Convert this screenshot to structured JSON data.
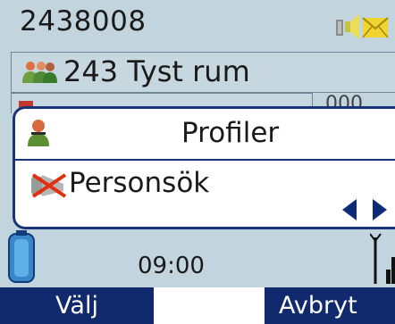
{
  "header": {
    "extension": "2438008",
    "icons": [
      "headset-icon",
      "speaker-icon",
      "envelope-icon"
    ]
  },
  "profile_row": {
    "icon": "group-icon",
    "label": "243 Tyst rum"
  },
  "hidden_row": {
    "time_fragment": "000"
  },
  "popup": {
    "title": "Profiler",
    "title_icon": "person-icon",
    "option_label": "Personsök",
    "option_icon": "muted-pager-icon",
    "nav_icons": [
      "arrow-left-icon",
      "arrow-right-icon"
    ]
  },
  "status": {
    "clock": "09:00",
    "icons": [
      "battery-icon",
      "signal-icon"
    ]
  },
  "softkeys": {
    "left": "Välj",
    "right": "Avbryt"
  },
  "colors": {
    "background": "#c2d4dd",
    "softkey_bar": "#112a6d",
    "popup_border": "#1b3478",
    "accent_red": "#e03010"
  }
}
